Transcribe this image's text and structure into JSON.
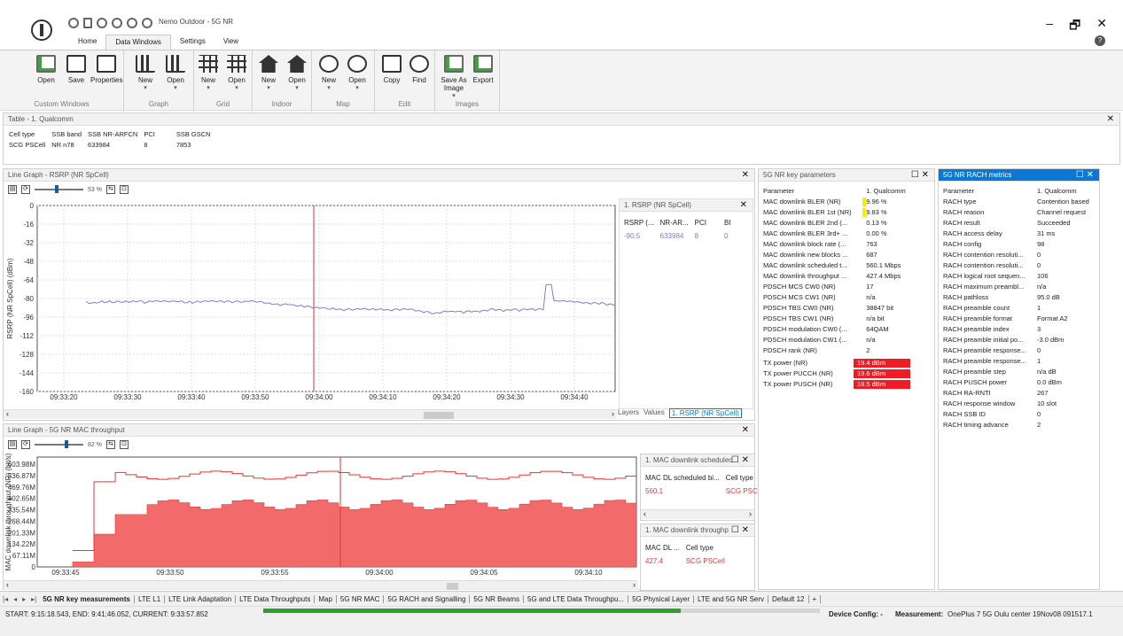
{
  "app": {
    "title": "Nemo Outdoor - 5G NR",
    "window_controls": [
      "–",
      "🗗",
      "✕"
    ],
    "help": "?"
  },
  "menu_tabs": [
    "Home",
    "Data Windows",
    "Settings",
    "View"
  ],
  "ribbon_groups": [
    {
      "name": "Custom Windows",
      "buttons": [
        "Open",
        "Save",
        "Properties"
      ]
    },
    {
      "name": "Graph",
      "buttons": [
        "New",
        "Open"
      ]
    },
    {
      "name": "Grid",
      "buttons": [
        "New",
        "Open"
      ]
    },
    {
      "name": "Indoor",
      "buttons": [
        "New",
        "Open"
      ]
    },
    {
      "name": "Map",
      "buttons": [
        "New",
        "Open"
      ]
    },
    {
      "name": "Edit",
      "buttons": [
        "Copy",
        "Find"
      ]
    },
    {
      "name": "Images",
      "buttons": [
        "Save As Image",
        "Export"
      ]
    }
  ],
  "table_panel": {
    "title": "Table - 1. Qualcomm",
    "headers": [
      "Cell type",
      "SSB band",
      "SSB NR-ARFCN",
      "PCI",
      "SSB GSCN"
    ],
    "row": [
      "SCG PSCell",
      "NR n78",
      "633984",
      "8",
      "7853"
    ]
  },
  "graph1": {
    "title": "Line Graph - RSRP (NR SpCell)",
    "zoom": "53 %",
    "ylabel": "RSRP (NR SpCell) (dBm)",
    "yticks": [
      "0",
      "-16",
      "-32",
      "-48",
      "-64",
      "-80",
      "-96",
      "-112",
      "-128",
      "-144",
      "-160"
    ],
    "xticks": [
      "09:33:20",
      "09:33:30",
      "09:33:40",
      "09:33:50",
      "09:34:00",
      "09:34:10",
      "09:34:20",
      "09:34:30",
      "09:34:40"
    ],
    "legend_title": "1. RSRP (NR SpCell)",
    "legend_headers": [
      "RSRP (...",
      "NR-AR...",
      "PCI",
      "BI"
    ],
    "legend_values": [
      "-90.5",
      "633984",
      "8",
      "0"
    ],
    "subtabs": [
      "Layers",
      "Values",
      "1. RSRP (NR SpCell)"
    ]
  },
  "graph2": {
    "title": "Line Graph - 5G NR MAC throughput",
    "zoom": "82 %",
    "ylabel": "MAC downlink throughput (NR) (bit/s)",
    "yticks": [
      "603.98M",
      "536.87M",
      "469.76M",
      "402.65M",
      "335.54M",
      "268.44M",
      "201.33M",
      "134.22M",
      "67.11M",
      "0"
    ],
    "xticks": [
      "09:33:45",
      "09:33:50",
      "09:33:55",
      "09:34:00",
      "09:34:05",
      "09:34:10"
    ],
    "legend1_title": "1. MAC downlink schedulec",
    "legend1_headers": [
      "MAC DL scheduled bi...",
      "Cell type"
    ],
    "legend1_values": [
      "560.1",
      "SCG PSCe"
    ],
    "legend2_title": "1. MAC downlink throughp",
    "legend2_headers": [
      "MAC DL ...",
      "Cell type"
    ],
    "legend2_values": [
      "427.4",
      "SCG PSCell"
    ]
  },
  "key_params": {
    "title": "5G NR key parameters",
    "header": [
      "Parameter",
      "1. Qualcomm"
    ],
    "rows": [
      [
        "MAC downlink BLER (NR)",
        "9.96 %"
      ],
      [
        "MAC downlink BLER 1st (NR)",
        "9.83 %"
      ],
      [
        "MAC downlink BLER 2nd (...",
        "0.13 %"
      ],
      [
        "MAC downlink BLER 3rd+ ...",
        "0.00 %"
      ],
      [
        "MAC downlink block rate (...",
        "763"
      ],
      [
        "MAC downlink new blocks ...",
        "687"
      ],
      [
        "MAC downlink scheduled t...",
        "560.1 Mbps"
      ],
      [
        "MAC downlink throughput ...",
        "427.4 Mbps"
      ],
      [
        "PDSCH MCS CW0 (NR)",
        "17"
      ],
      [
        "PDSCH MCS CW1 (NR)",
        "n/a"
      ],
      [
        "PDSCH TBS CW0 (NR)",
        "38847 bit"
      ],
      [
        "PDSCH TBS CW1 (NR)",
        "n/a bit"
      ],
      [
        "PDSCH modulation CW0 (...",
        "64QAM"
      ],
      [
        "PDSCH modulation CW1 (...",
        "n/a"
      ],
      [
        "PDSCH rank (NR)",
        "2"
      ]
    ],
    "tx_rows": [
      [
        "TX power (NR)",
        "19.4 dBm"
      ],
      [
        "TX power PUCCH (NR)",
        "19.6 dBm"
      ],
      [
        "TX power PUSCH (NR)",
        "18.5 dBm"
      ]
    ]
  },
  "rach": {
    "title": "5G NR RACH metrics",
    "header": [
      "Parameter",
      "1. Qualcomm"
    ],
    "rows": [
      [
        "RACH type",
        "Contention based"
      ],
      [
        "RACH reason",
        "Channel request"
      ],
      [
        "RACH result",
        "Succeeded"
      ],
      [
        "RACH access delay",
        "31 ms"
      ],
      [
        "RACH config",
        "98"
      ],
      [
        "RACH contention resoluti...",
        "0"
      ],
      [
        "RACH contention resoluti...",
        "0"
      ],
      [
        "RACH logical root sequen...",
        "106"
      ],
      [
        "RACH maximum preambl...",
        "n/a"
      ],
      [
        "RACH pathloss",
        "95.0 dB"
      ],
      [
        "RACH preamble count",
        "1"
      ],
      [
        "RACH preamble format",
        "Format A2"
      ],
      [
        "RACH preamble index",
        "3"
      ],
      [
        "RACH preamble initial po...",
        "-3.0 dBm"
      ],
      [
        "RACH preamble response...",
        "0"
      ],
      [
        "RACH preamble response...",
        "1"
      ],
      [
        "RACH preamble step",
        "n/a dB"
      ],
      [
        "RACH PUSCH power",
        "0.0 dBm"
      ],
      [
        "RACH RA-RNTI",
        "267"
      ],
      [
        "RACH response window",
        "10 slot"
      ],
      [
        "RACH SSB ID",
        "0"
      ],
      [
        "RACH timing advance",
        "2"
      ]
    ]
  },
  "bottom_tabs": [
    "5G NR key measurements",
    "LTE L1",
    "LTE Link Adaptation",
    "LTE Data Throughputs",
    "Map",
    "5G NR MAC",
    "5G RACH and Signalling",
    "5G NR Beams",
    "5G and LTE Data Throughpu...",
    "5G Physical Layer",
    "LTE and 5G NR Serv",
    "Default 12",
    "+"
  ],
  "status": {
    "left": "START: 9:15:18.543, END: 9:41:46.052, CURRENT: 9:33:57.852",
    "device_label": "Device Config: -",
    "measurement_label": "Measurement:",
    "measurement_value": "OnePlus 7 5G Oulu center 19Nov08 091517.1",
    "progress": 0.75
  }
}
